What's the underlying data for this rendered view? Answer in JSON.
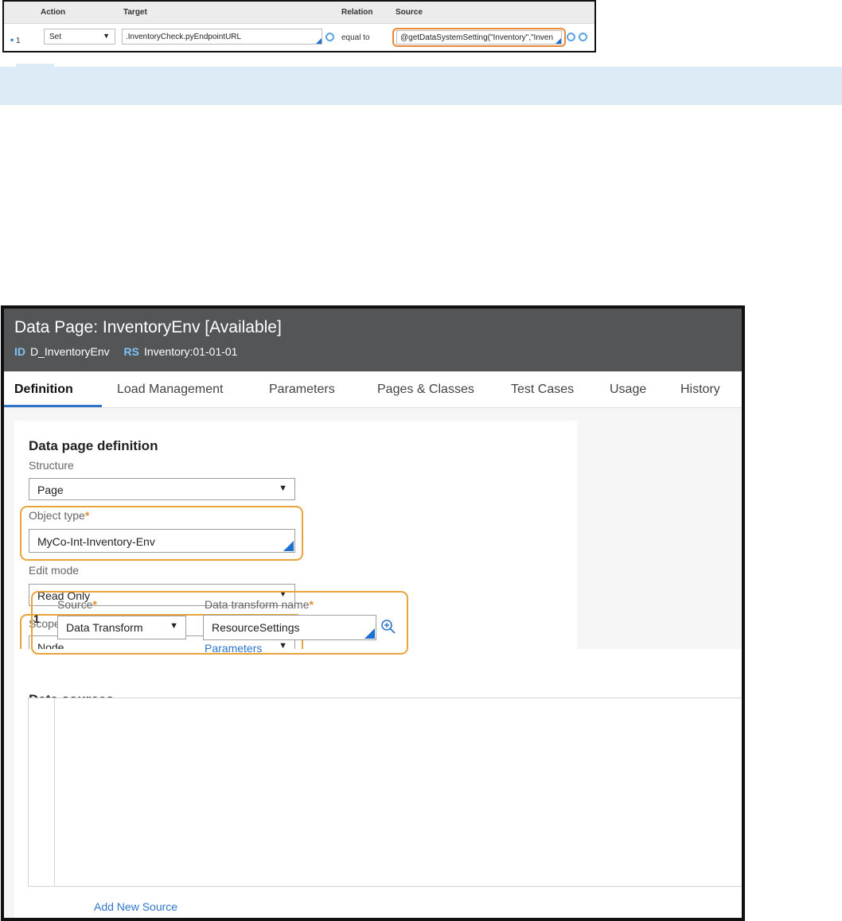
{
  "grid": {
    "headers": {
      "action": "Action",
      "target": "Target",
      "relation": "Relation",
      "source": "Source"
    },
    "row": {
      "number": "1",
      "action": "Set",
      "target": ".InventoryCheck.pyEndpointURL",
      "relation": "equal to",
      "source": "@getDataSystemSetting(\"Inventory\",\"Inven"
    }
  },
  "datapage": {
    "title": "Data Page: InventoryEnv [Available]",
    "id_label": "ID",
    "id_value": "D_InventoryEnv",
    "rs_label": "RS",
    "rs_value": "Inventory:01-01-01",
    "tabs": [
      "Definition",
      "Load Management",
      "Parameters",
      "Pages & Classes",
      "Test Cases",
      "Usage",
      "History"
    ],
    "definition": {
      "heading": "Data page definition",
      "structure_label": "Structure",
      "structure_value": "Page",
      "object_type_label": "Object type",
      "object_type_value": "MyCo-Int-Inventory-Env",
      "edit_mode_label": "Edit mode",
      "edit_mode_value": "Read Only",
      "scope_label": "Scope",
      "scope_value": "Node"
    },
    "sources": {
      "heading": "Data sources",
      "row_number": "1",
      "source_label": "Source",
      "source_value": "Data Transform",
      "transform_label": "Data transform name",
      "transform_value": "ResourceSettings",
      "parameters_link": "Parameters",
      "add_link": "Add New Source"
    },
    "required_mark": "*"
  },
  "colors": {
    "accent": "#2d76c8",
    "highlight": "#e8a33a",
    "header_bg": "#545557",
    "required": "#e88b2e"
  }
}
